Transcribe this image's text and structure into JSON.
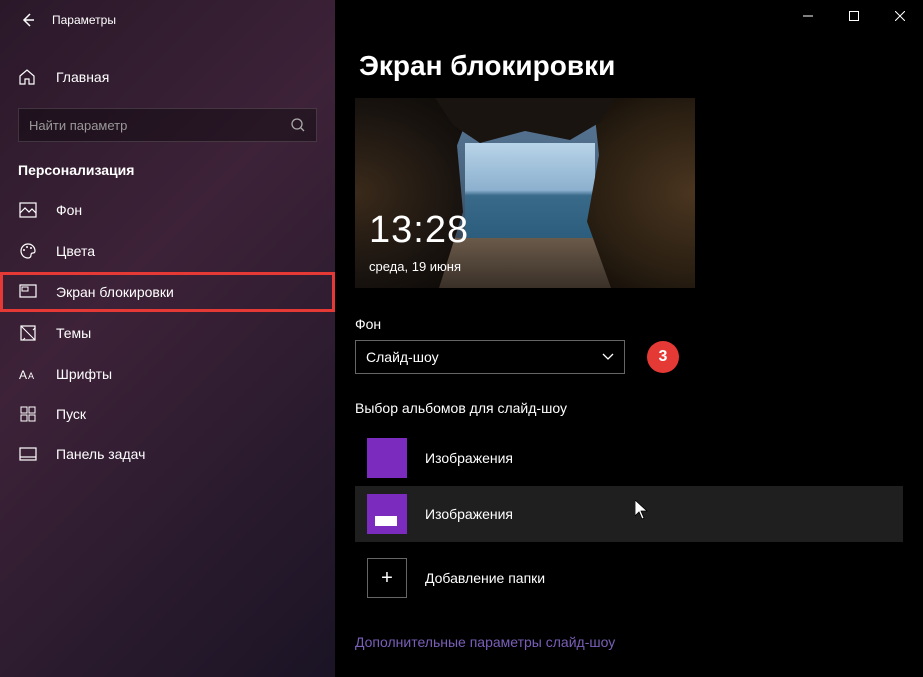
{
  "titlebar": {
    "title": "Параметры"
  },
  "sidebar": {
    "home_label": "Главная",
    "search_placeholder": "Найти параметр",
    "section": "Персонализация",
    "items": [
      {
        "label": "Фон"
      },
      {
        "label": "Цвета"
      },
      {
        "label": "Экран блокировки"
      },
      {
        "label": "Темы"
      },
      {
        "label": "Шрифты"
      },
      {
        "label": "Пуск"
      },
      {
        "label": "Панель задач"
      }
    ]
  },
  "main": {
    "page_title": "Экран блокировки",
    "preview": {
      "time": "13:28",
      "date": "среда, 19 июня"
    },
    "background_label": "Фон",
    "background_dropdown": "Слайд-шоу",
    "annotation": "3",
    "albums_label": "Выбор альбомов для слайд-шоу",
    "albums": [
      {
        "label": "Изображения"
      },
      {
        "label": "Изображения"
      }
    ],
    "add_folder_label": "Добавление папки",
    "more_params_link": "Дополнительные параметры слайд-шоу"
  }
}
